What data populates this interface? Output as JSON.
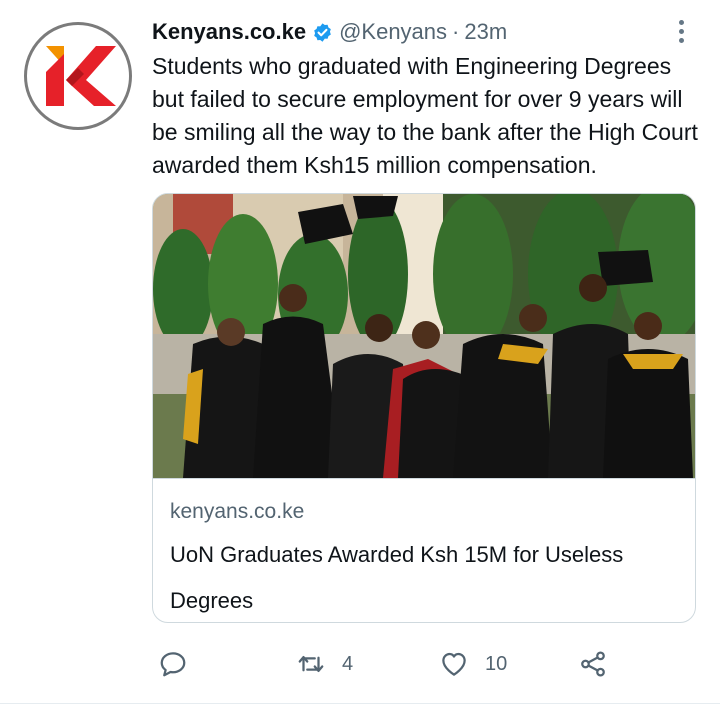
{
  "tweet": {
    "author_name": "Kenyans.co.ke",
    "author_handle": "@Kenyans",
    "separator": "·",
    "timestamp": "23m",
    "text": "Students who graduated with Engineering Degrees but failed to secure employment for over 9 years will be smiling all the way to the bank after the High Court awarded them Ksh15 million compensation.",
    "avatar_icon": "kenyans-k-logo",
    "verified_icon": "verified-badge-icon",
    "more_icon": "more-options-icon"
  },
  "card": {
    "image_icon": "graduates-photo",
    "domain": "kenyans.co.ke",
    "title": "UoN Graduates Awarded Ksh 15M for Useless Degrees"
  },
  "actions": {
    "reply": {
      "icon": "reply-icon",
      "count": ""
    },
    "retweet": {
      "icon": "retweet-icon",
      "count": "4"
    },
    "like": {
      "icon": "heart-icon",
      "count": "10"
    },
    "share": {
      "icon": "share-icon",
      "count": ""
    }
  },
  "colors": {
    "text_primary": "#0f1419",
    "text_secondary": "#536471",
    "verified_blue": "#1d9bf0",
    "logo_red": "#e62129",
    "logo_orange": "#f39200",
    "border": "#cfd9de"
  }
}
